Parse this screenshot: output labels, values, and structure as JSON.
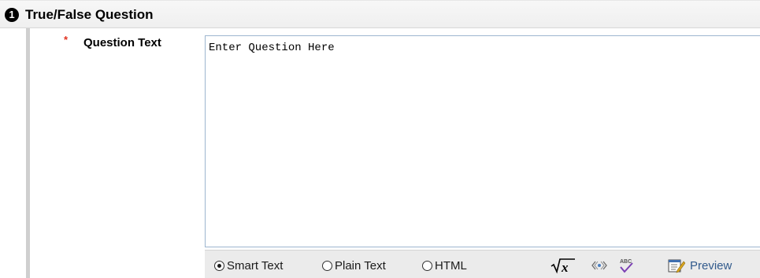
{
  "section": {
    "step_number": "1",
    "title": "True/False Question"
  },
  "question_field": {
    "required_marker": "*",
    "label": "Question Text",
    "value": "Enter Question Here"
  },
  "toolbar": {
    "text_format_options": [
      {
        "label": "Smart Text",
        "selected": true
      },
      {
        "label": "Plain Text",
        "selected": false
      },
      {
        "label": "HTML",
        "selected": false
      }
    ],
    "tools": [
      {
        "icon": "math-sqrt-x-icon"
      },
      {
        "icon": "embed-code-icon"
      },
      {
        "icon": "spell-check-icon"
      }
    ],
    "preview_label": "Preview",
    "preview_icon": "preview-edit-icon"
  },
  "colors": {
    "required": "#e0301e",
    "preview_link": "#315a8c",
    "textarea_border": "#9db6cf"
  }
}
